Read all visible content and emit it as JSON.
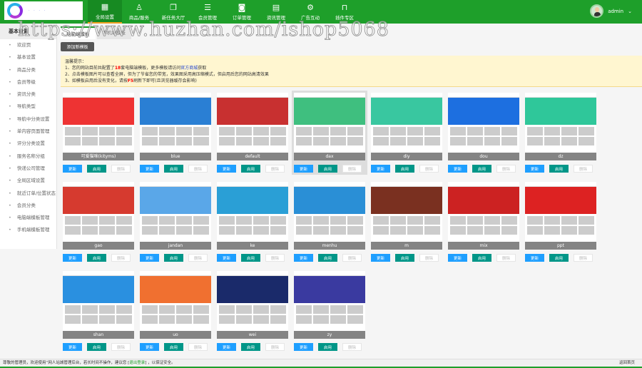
{
  "header": {
    "logo_text": "· · · ·",
    "nav": [
      {
        "label": "全局设置",
        "icon": "grid-icon",
        "glyph": "▦",
        "active": true
      },
      {
        "label": "商品/服务",
        "icon": "user-icon",
        "glyph": "♙"
      },
      {
        "label": "新任务大厅",
        "icon": "copy-icon",
        "glyph": "❐"
      },
      {
        "label": "会员管理",
        "icon": "list-icon",
        "glyph": "☰"
      },
      {
        "label": "订单管理",
        "icon": "camera-icon",
        "glyph": "◙"
      },
      {
        "label": "资讯管理",
        "icon": "calendar-icon",
        "glyph": "▤"
      },
      {
        "label": "广告互动",
        "icon": "gear-icon",
        "glyph": "⚙"
      },
      {
        "label": "插件专区",
        "icon": "bag-icon",
        "glyph": "⊓"
      }
    ],
    "user": "admin"
  },
  "watermark": "https://www.huzhan.com/ishop5068",
  "sidebar": {
    "title": "基本设置",
    "items": [
      "欢迎页",
      "基本设置",
      "商品分类",
      "会员等级",
      "资讯分类",
      "导航类型",
      "导航中分类设置",
      "单内容页面管理",
      "评分分类设置",
      "服务名称分组",
      "快递公司管理",
      "全局区域设置",
      "就近订单/位置状态",
      "会员分类",
      "电脑端模板管理",
      "手机端模板管理"
    ]
  },
  "tabs": [
    "电脑端模板",
    "手机端模板"
  ],
  "add_button": "添加新模板",
  "notice": {
    "title": "温馨提示：",
    "l1a": "1、您的网站目前共配置了",
    "count": "18",
    "l1b": "套电脑端模板，更多模板请访问",
    "link": "官方商城",
    "l1c": "获取",
    "l2": "2、点击模板图片可以查看全屏，但为了节省您的带宽，效果图采用高压缩模式，但启用后您的网站高清效果",
    "l3a": "3、如模板启用后没有变化，请按",
    "key": "F5",
    "l3b": "刷新下即可(且浏览器缓存会影响)"
  },
  "buttons": {
    "update": "更新",
    "enable": "启用",
    "delete": "删除"
  },
  "templates": [
    {
      "name": "可爱猫咪(kityms)",
      "color": "#e33"
    },
    {
      "name": "blue",
      "color": "#2a7fd4"
    },
    {
      "name": "default",
      "color": "#c83030"
    },
    {
      "name": "dax",
      "color": "#3fbf7f"
    },
    {
      "name": "diy",
      "color": "#39c7a0"
    },
    {
      "name": "dou",
      "color": "#1d6fe0"
    },
    {
      "name": "dz",
      "color": "#2fc79a"
    },
    {
      "name": "gao",
      "color": "#d63a2f"
    },
    {
      "name": "jandan",
      "color": "#5aa7e8"
    },
    {
      "name": "ke",
      "color": "#2a9fd6"
    },
    {
      "name": "menhu",
      "color": "#2a8fd6"
    },
    {
      "name": "m",
      "color": "#7a3020"
    },
    {
      "name": "mix",
      "color": "#c22"
    },
    {
      "name": "ppt",
      "color": "#d22"
    },
    {
      "name": "shan",
      "color": "#2a90e0"
    },
    {
      "name": "uo",
      "color": "#f07030"
    },
    {
      "name": "wei",
      "color": "#1a2a6a"
    },
    {
      "name": "zy",
      "color": "#3a3aa0"
    }
  ],
  "footer": {
    "text": "尊敬的管理员，欢迎使用“网人站城管理后台，若长时间不操作，建议您 [",
    "logout": "退出登录",
    "text2": "] ，以保证安全。",
    "home": "返回首页"
  }
}
